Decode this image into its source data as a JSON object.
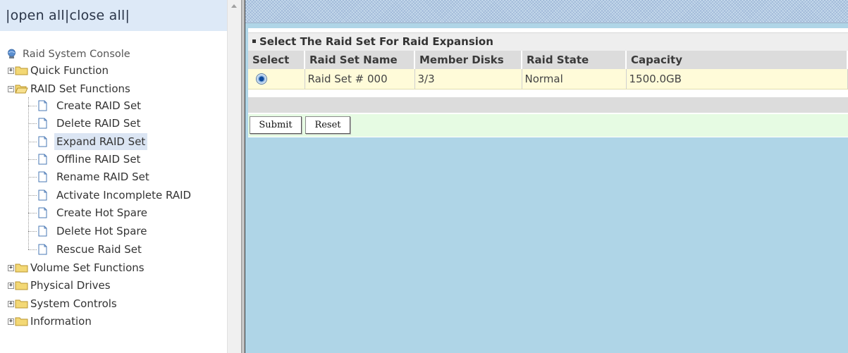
{
  "left_frame": {
    "toggle_text": "|open all|close all|",
    "root_label": "Raid System Console",
    "tree": {
      "quick_function": "Quick Function",
      "raid_set_functions": "RAID Set Functions",
      "raid_children": [
        "Create RAID Set",
        "Delete RAID Set",
        "Expand RAID Set",
        "Offline RAID Set",
        "Rename RAID Set",
        "Activate Incomplete RAID",
        "Create Hot Spare",
        "Delete Hot Spare",
        "Rescue Raid Set"
      ],
      "selected_child": "Expand RAID Set",
      "volume_set_functions": "Volume Set Functions",
      "physical_drives": "Physical Drives",
      "system_controls": "System Controls",
      "information": "Information"
    }
  },
  "main": {
    "caption": "Select The Raid Set For Raid Expansion",
    "columns": [
      "Select",
      "Raid Set Name",
      "Member Disks",
      "Raid State",
      "Capacity"
    ],
    "rows": [
      {
        "selected": true,
        "name": "Raid Set # 000",
        "member_disks": "3/3",
        "state": "Normal",
        "capacity": "1500.0GB"
      }
    ],
    "submit_label": "Submit",
    "reset_label": "Reset"
  },
  "colors": {
    "right_background": "#afd5e7",
    "row_background": "#fffbd9",
    "button_bar": "#e6fbe3",
    "header_gray": "#dcdcdc"
  },
  "icons": {
    "root": "console-globe-icon",
    "folder": "folder-icon",
    "page": "page-icon",
    "expander": "plus-minus-expander-icon"
  }
}
